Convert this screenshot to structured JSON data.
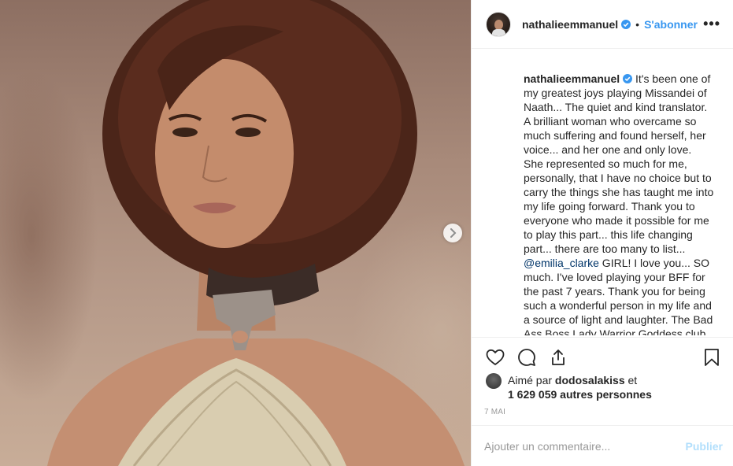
{
  "post": {
    "username": "nathalieemmanuel",
    "follow_label": "S'abonner",
    "separator": "•",
    "more_label": "•••"
  },
  "caption": {
    "username": "nathalieemmanuel",
    "text_before_mention": " It's been one of my greatest joys playing Missandei of Naath... The quiet and kind translator. A brilliant woman who overcame so much suffering and found herself, her voice... and her one and only love. She represented so much for me, personally, that I have no choice but to carry the things she has taught me into my life going forward. Thank you to everyone who made it possible for me to play this part... this life changing part... there are too many to list... ",
    "mention": "@emilia_clarke",
    "text_after_mention": " GIRL! I love you... SO much. I've loved playing your BFF for the past 7 years. Thank you for being such a wonderful person in my life and a source of light and laughter. The Bad Ass Boss Lady Warrior Goddess club"
  },
  "likes": {
    "prefix": "Aimé par ",
    "liked_by": "dodosalakiss",
    "middle": " et",
    "others": "1 629 059 autres personnes"
  },
  "timestamp": "7 MAI",
  "comment_box": {
    "placeholder": "Ajouter un commentaire...",
    "publish_label": "Publier"
  },
  "icons": {
    "like": "heart-icon",
    "comment": "comment-icon",
    "share": "share-icon",
    "save": "bookmark-icon",
    "verified": "verified-badge-icon",
    "next": "chevron-right-icon"
  },
  "colors": {
    "accent": "#3897f0",
    "verified": "#3897f0",
    "publish_disabled": "#b2dffc",
    "mention": "#003569"
  }
}
